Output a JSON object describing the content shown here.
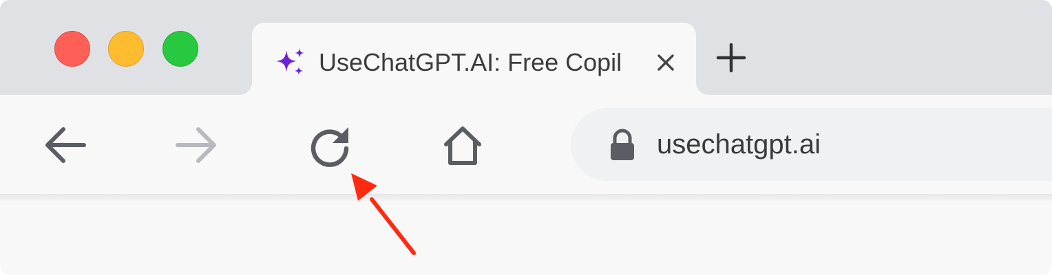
{
  "window": {
    "controls": [
      "close",
      "minimize",
      "maximize"
    ],
    "colors": {
      "close": "#fe5f57",
      "minimize": "#febc2e",
      "maximize": "#28c840"
    }
  },
  "tab": {
    "title": "UseChatGPT.AI: Free Copil",
    "favicon": "sparkles-icon",
    "favicon_color": "#6b21d8",
    "close_icon": "close-icon"
  },
  "tabstrip": {
    "new_tab_icon": "plus-icon"
  },
  "toolbar": {
    "buttons": [
      "back-arrow-icon",
      "forward-arrow-icon",
      "reload-icon",
      "home-icon"
    ],
    "forward_disabled": true
  },
  "omnibox": {
    "url": "usechatgpt.ai",
    "security_icon": "lock-icon"
  },
  "annotation": {
    "type": "arrow",
    "points_to": "reload-button",
    "color": "#ff2a10"
  }
}
